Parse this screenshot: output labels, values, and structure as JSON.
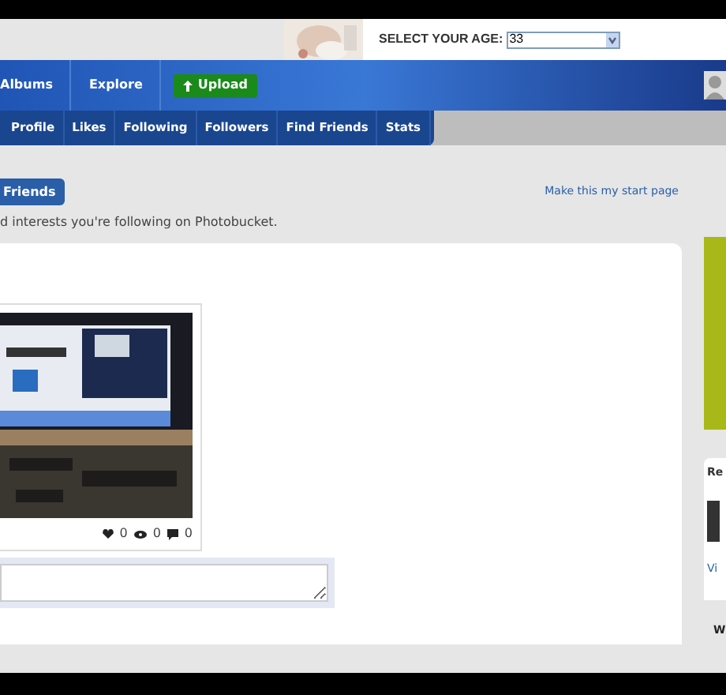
{
  "ad": {
    "label": "SELECT YOUR AGE:",
    "age_value": "33"
  },
  "nav": {
    "items": [
      "Albums",
      "Explore"
    ],
    "upload_button": "Upload"
  },
  "tabs": [
    "Profile",
    "Likes",
    "Following",
    "Followers",
    "Find Friends",
    "Stats"
  ],
  "friends_button": "Friends",
  "start_page_link": "Make this my start page",
  "description": "d interests you're following on Photobucket.",
  "photo": {
    "kind": "picture",
    "likes": "0",
    "views": "0",
    "comments": "0"
  },
  "side_panel": {
    "heading": "Re",
    "link": "Vi"
  },
  "footer_text": "W"
}
